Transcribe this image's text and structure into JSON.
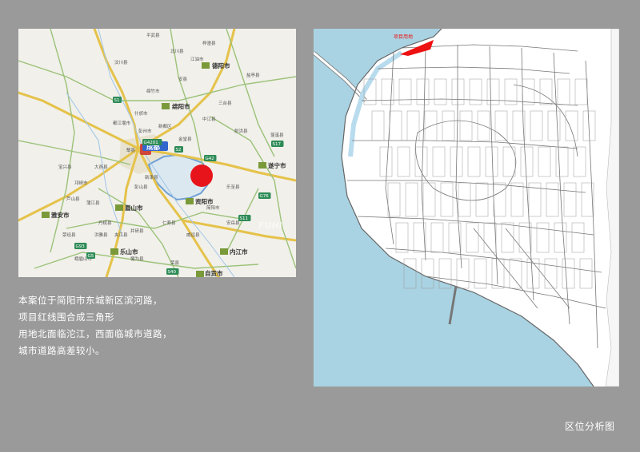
{
  "region_map": {
    "major_cities": [
      {
        "label": "成都"
      },
      {
        "label": "德阳市"
      },
      {
        "label": "绵阳市"
      },
      {
        "label": "遂宁市"
      },
      {
        "label": "资阳市"
      },
      {
        "label": "眉山市"
      },
      {
        "label": "雅安市"
      },
      {
        "label": "乐山市"
      },
      {
        "label": "内江市"
      },
      {
        "label": "自贡市"
      }
    ],
    "counties": [
      "汶川县",
      "安县",
      "绵竹市",
      "什邡市",
      "彭州市",
      "都江堰市",
      "郫县",
      "新都区",
      "金堂县",
      "中江县",
      "三台县",
      "射洪县",
      "乐至县",
      "安岳县",
      "简阳市",
      "大邑县",
      "邛崃市",
      "蒲江县",
      "丹棱县",
      "洪雅县",
      "夹江县",
      "井研县",
      "威远县",
      "仁寿县",
      "彭山县",
      "新津县",
      "荥经县",
      "芦山县",
      "宝兴县",
      "峨眉山市",
      "犍为县",
      "荣县",
      "盐亭县",
      "梓潼县",
      "江油市",
      "北川县",
      "平武县",
      "蓬溪县"
    ],
    "highways": [
      "G5",
      "G93",
      "G42",
      "S1",
      "S2",
      "S17",
      "G4201",
      "S11",
      "S40",
      "G76"
    ],
    "marker_color": "#e8141b",
    "watermark": "FUHI"
  },
  "site_plan": {
    "project_label": "项目用地",
    "project_color": "#ee1111",
    "river_color": "#a9d3e3"
  },
  "description": [
    "本案位于简阳市东城新区滨河路，",
    "项目红线围合成三角形",
    "用地北面临沱江，西面临城市道路，",
    "城市道路高差较小。"
  ],
  "page_title": "区位分析图"
}
